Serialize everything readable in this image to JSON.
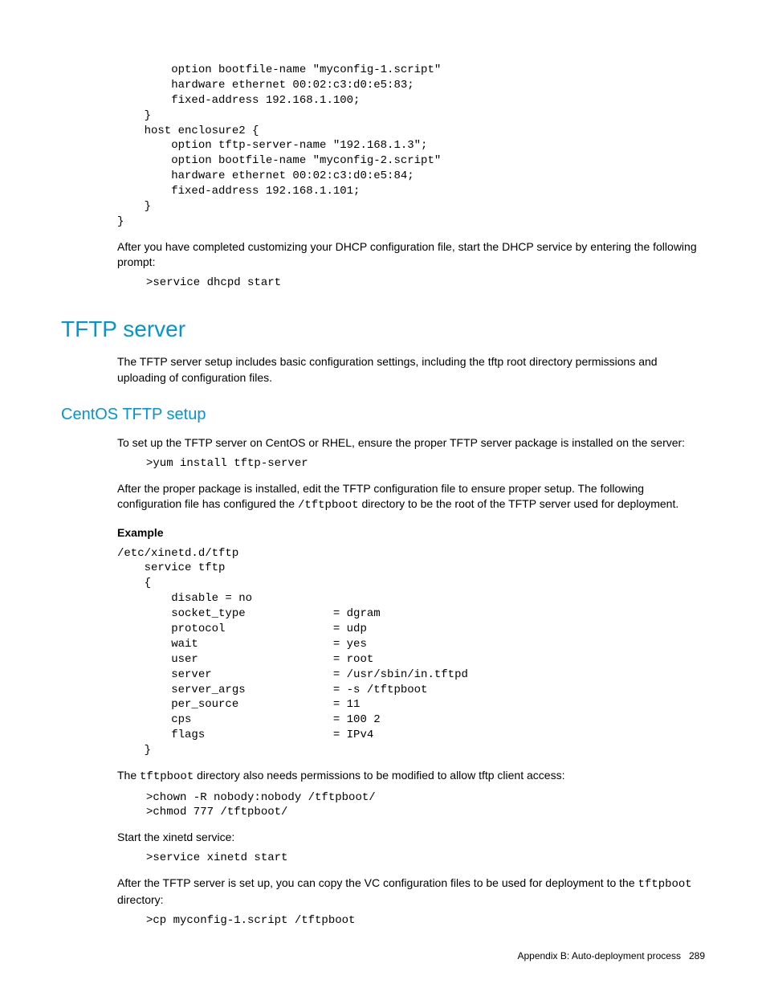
{
  "code1": "        option bootfile-name \"myconfig-1.script\"\n        hardware ethernet 00:02:c3:d0:e5:83;\n        fixed-address 192.168.1.100;\n    }\n    host enclosure2 {\n        option tftp-server-name \"192.168.1.3\";\n        option bootfile-name \"myconfig-2.script\"\n        hardware ethernet 00:02:c3:d0:e5:84;\n        fixed-address 192.168.1.101;\n    }\n}",
  "p1": "After you have completed customizing your DHCP configuration file, start the DHCP service by entering the following prompt:",
  "code2": ">service dhcpd start",
  "h1": "TFTP server",
  "p2": "The TFTP server setup includes basic configuration settings, including the tftp root directory permissions and uploading of configuration files.",
  "h2": "CentOS TFTP setup",
  "p3": "To set up the TFTP server on CentOS or RHEL, ensure the proper TFTP server package is installed on the server:",
  "code3": ">yum install tftp-server",
  "p4a": "After the proper package is installed, edit the TFTP configuration file to ensure proper setup. The following configuration file has configured the ",
  "p4code": "/tftpboot",
  "p4b": " directory to be the root of the TFTP server used for deployment.",
  "example_label": "Example",
  "code4": "/etc/xinetd.d/tftp\n    service tftp\n    {\n        disable = no\n        socket_type             = dgram\n        protocol                = udp\n        wait                    = yes\n        user                    = root\n        server                  = /usr/sbin/in.tftpd\n        server_args             = -s /tftpboot\n        per_source              = 11\n        cps                     = 100 2\n        flags                   = IPv4\n    }",
  "p5a": "The ",
  "p5code": "tftpboot",
  "p5b": " directory also needs permissions to be modified to allow tftp client access:",
  "code5": ">chown -R nobody:nobody /tftpboot/\n>chmod 777 /tftpboot/",
  "p6": "Start the xinetd service:",
  "code6": ">service xinetd start",
  "p7a": "After the TFTP server is set up, you can copy the VC configuration files to be used for deployment to the ",
  "p7code": "tftpboot",
  "p7b": " directory:",
  "code7": ">cp myconfig-1.script /tftpboot",
  "footer_text": "Appendix B: Auto-deployment process",
  "page_num": "289"
}
